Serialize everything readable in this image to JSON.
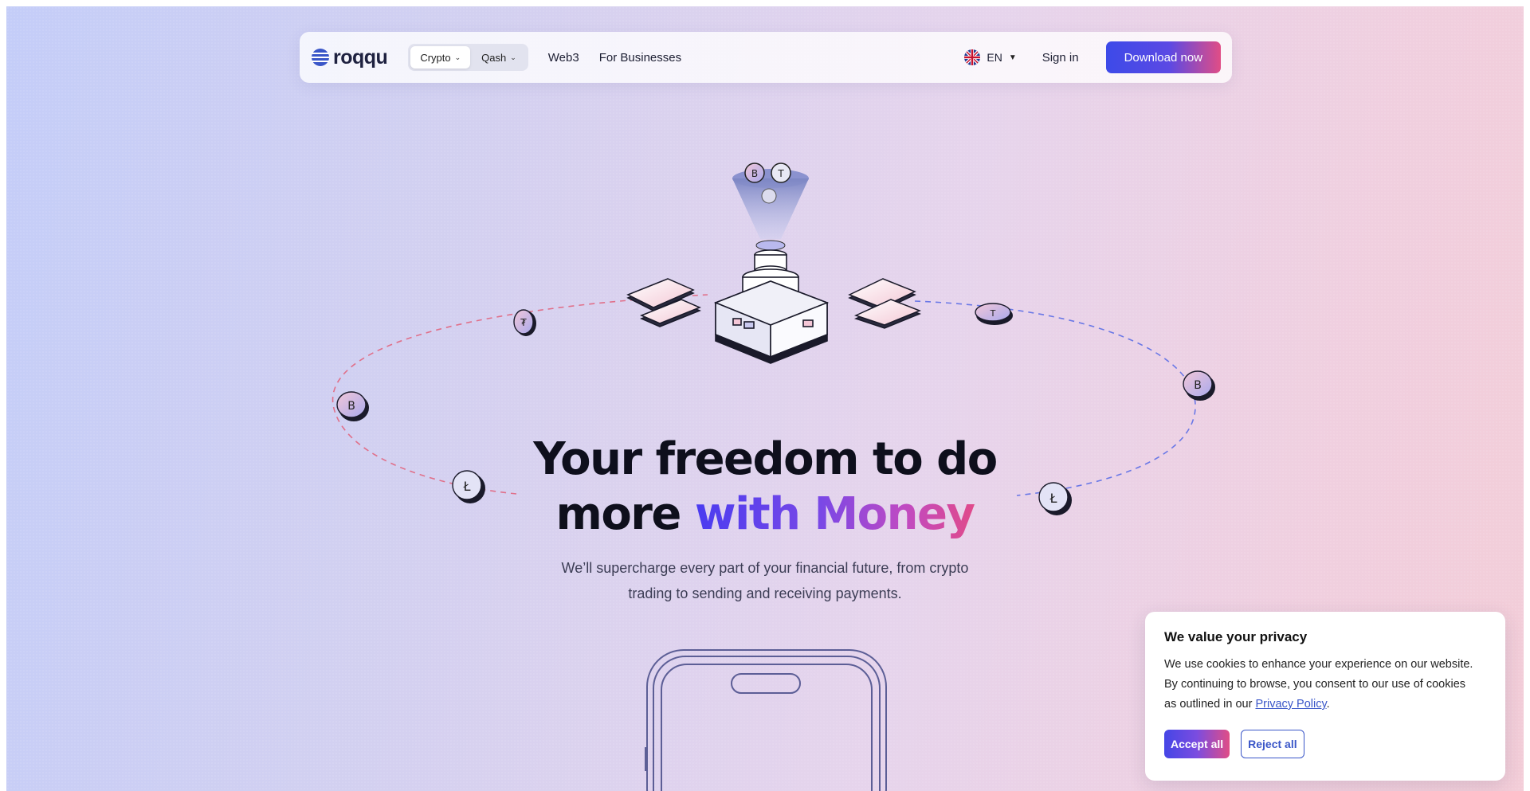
{
  "nav": {
    "logo_text": "roqqu",
    "segments": [
      {
        "label": "Crypto",
        "active": true
      },
      {
        "label": "Qash",
        "active": false
      }
    ],
    "links": [
      "Web3",
      "For Businesses"
    ],
    "language": "EN",
    "sign_in": "Sign in",
    "download": "Download now"
  },
  "hero": {
    "headline_line1": "Your freedom to do",
    "headline_line2_plain": "more ",
    "headline_line2_gradient": "with Money",
    "subtext_line1": "We’ll supercharge every part of your financial future, from crypto",
    "subtext_line2": "trading to sending and receiving payments."
  },
  "cookie": {
    "title": "We value your privacy",
    "body_line1": "We use cookies to enhance your experience on our website.",
    "body_line2": "By continuing to browse, you consent to our use of cookies",
    "body_line3_prefix": "as outlined in our ",
    "policy_link": "Privacy Policy",
    "body_line3_suffix": ".",
    "accept": "Accept all",
    "reject": "Reject all"
  },
  "icons": {
    "coins": [
      "tether-coin-icon",
      "bitcoin-coin-icon",
      "litecoin-coin-icon",
      "ethereum-coin-icon"
    ],
    "flag": "uk-flag-icon"
  },
  "colors": {
    "brand_blue": "#3d4ae8",
    "brand_pink": "#e04d86",
    "link_blue": "#3a56c8"
  }
}
